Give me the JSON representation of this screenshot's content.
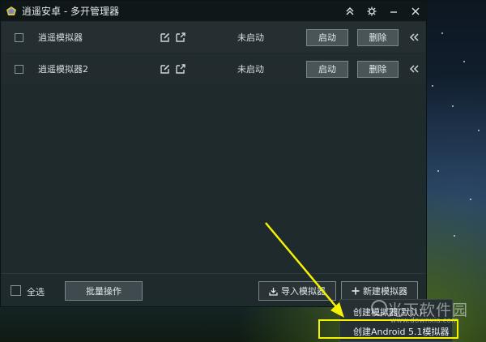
{
  "window": {
    "title": "逍遥安卓 - 多开管理器"
  },
  "emulators": [
    {
      "name": "逍遥模拟器",
      "status": "未启动",
      "start_label": "启动",
      "delete_label": "删除"
    },
    {
      "name": "逍遥模拟器2",
      "status": "未启动",
      "start_label": "启动",
      "delete_label": "删除"
    }
  ],
  "footer": {
    "select_all": "全选",
    "batch_label": "批量操作",
    "import_label": "导入模拟器",
    "new_label": "新建模拟器"
  },
  "dropdown": {
    "items": [
      "创建模拟器(默认)",
      "创建Android 5.1模拟器"
    ]
  },
  "watermark": {
    "main": "光下软件园",
    "sub": "www.downxia.com"
  },
  "colors": {
    "highlight": "#f5f200",
    "titlebar": "#0f1719",
    "window_bg": "#1f2a2d"
  },
  "icons": {
    "title_controls": [
      "collapse-up-icon",
      "settings-gear-icon",
      "minimize-icon",
      "close-icon"
    ],
    "row": [
      "edit-icon",
      "open-external-icon",
      "collapse-left-icon"
    ]
  }
}
